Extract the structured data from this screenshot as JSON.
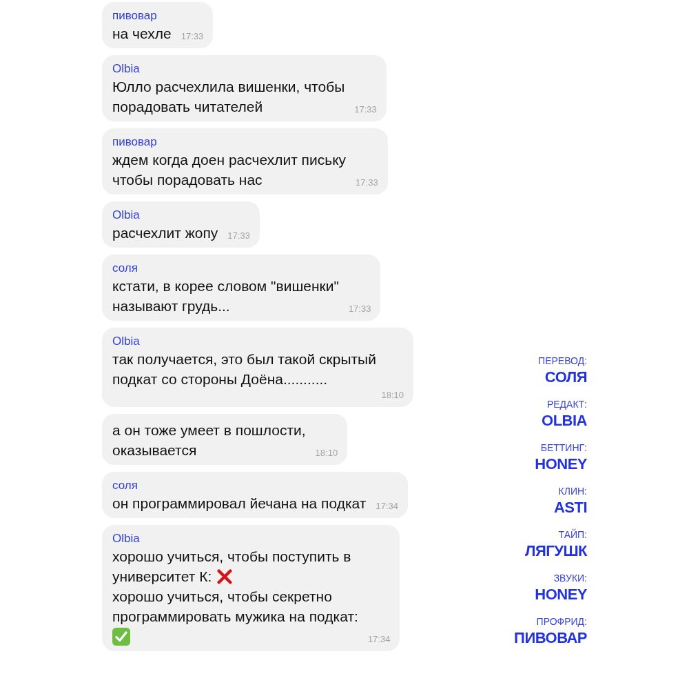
{
  "messages": [
    {
      "sender": "пивовар",
      "lines": [
        [
          {
            "kind": "text",
            "text": "на чехле"
          }
        ]
      ],
      "time": "17:33"
    },
    {
      "sender": "Olbia",
      "lines": [
        [
          {
            "kind": "text",
            "text": "Юлло расчехлила вишенки, чтобы"
          }
        ],
        [
          {
            "kind": "text",
            "text": "порадовать читателей"
          }
        ]
      ],
      "time": "17:33"
    },
    {
      "sender": "пивовар",
      "lines": [
        [
          {
            "kind": "text",
            "text": "ждем когда доен расчехлит письку"
          }
        ],
        [
          {
            "kind": "text",
            "text": "чтобы порадовать нас"
          }
        ]
      ],
      "time": "17:33"
    },
    {
      "sender": "Olbia",
      "lines": [
        [
          {
            "kind": "text",
            "text": "расчехлит жопу"
          }
        ]
      ],
      "time": "17:33"
    },
    {
      "sender": "соля",
      "lines": [
        [
          {
            "kind": "text",
            "text": "кстати, в корее словом \"вишенки\""
          }
        ],
        [
          {
            "kind": "text",
            "text": "называют грудь..."
          }
        ]
      ],
      "time": "17:33"
    },
    {
      "sender": "Olbia",
      "lines": [
        [
          {
            "kind": "text",
            "text": "так получается, это был такой скрытый"
          }
        ],
        [
          {
            "kind": "text",
            "text": "подкат со стороны Доёна..........."
          }
        ]
      ],
      "time": "18:10"
    },
    {
      "lines": [
        [
          {
            "kind": "text",
            "text": "а он тоже умеет в пошлости,"
          }
        ],
        [
          {
            "kind": "text",
            "text": "оказывается"
          }
        ]
      ],
      "time": "18:10"
    },
    {
      "sender": "соля",
      "lines": [
        [
          {
            "kind": "text",
            "text": "он программировал йечана на подкат"
          }
        ]
      ],
      "time": "17:34"
    },
    {
      "sender": "Olbia",
      "lines": [
        [
          {
            "kind": "text",
            "text": "хорошо учиться, чтобы поступить в"
          }
        ],
        [
          {
            "kind": "text",
            "text": "университет К:"
          },
          {
            "kind": "cross"
          }
        ],
        [
          {
            "kind": "text",
            "text": "хорошо учиться, чтобы секретно"
          }
        ],
        [
          {
            "kind": "text",
            "text": "программировать мужика на подкат:"
          }
        ],
        [
          {
            "kind": "check"
          }
        ]
      ],
      "time": "17:34"
    }
  ],
  "credits": [
    {
      "role": "ПЕРЕВОД:",
      "name": "СОЛЯ"
    },
    {
      "role": "РЕДАКТ:",
      "name": "OLBIA"
    },
    {
      "role": "БЕТТИНГ:",
      "name": "HONEY"
    },
    {
      "role": "КЛИН:",
      "name": "ASTI"
    },
    {
      "role": "ТАЙП:",
      "name": "ЛЯГУШК"
    },
    {
      "role": "ЗВУКИ:",
      "name": "HONEY"
    },
    {
      "role": "ПРОФРИД:",
      "name": "ПИВОВАР"
    }
  ]
}
